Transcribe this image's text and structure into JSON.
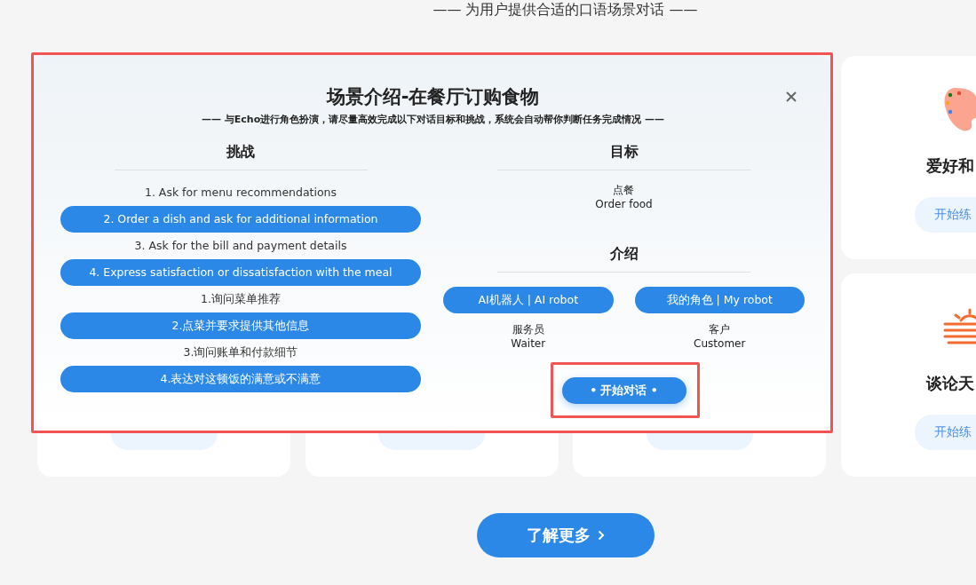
{
  "page_subtitle": "—— 为用户提供合适的口语场景对话 ——",
  "side_cards": [
    {
      "kind": "palette",
      "title": "爱好和",
      "button": "开始练"
    },
    {
      "kind": "sunset",
      "title": "谈论天",
      "button": "开始练"
    }
  ],
  "modal": {
    "title": "场景介绍-在餐厅订购食物",
    "subtitle": "—— 与**Echo**进行角色扮演，请尽量高效完成以下对话目标和挑战，系统会自动帮你判断任务完成情况 ——",
    "challenges": {
      "heading": "挑战",
      "items": [
        {
          "text": "1. Ask for menu recommendations",
          "highlighted": false
        },
        {
          "text": "2. Order a dish and ask for additional information",
          "highlighted": true
        },
        {
          "text": "3. Ask for the bill and payment details",
          "highlighted": false
        },
        {
          "text": "4. Express satisfaction or dissatisfaction with the meal",
          "highlighted": true
        },
        {
          "text": "1.询问菜单推荐",
          "highlighted": false
        },
        {
          "text": "2.点菜并要求提供其他信息",
          "highlighted": true
        },
        {
          "text": "3.询问账单和付款细节",
          "highlighted": false
        },
        {
          "text": "4.表达对这顿饭的满意或不满意",
          "highlighted": true
        }
      ]
    },
    "goal": {
      "heading": "目标",
      "lines": [
        "点餐",
        "Order food"
      ]
    },
    "intro": {
      "heading": "介绍",
      "roles": [
        {
          "label": "AI机器人 | AI robot",
          "lines": [
            "服务员",
            "Waiter"
          ]
        },
        {
          "label": "我的角色 | My robot",
          "lines": [
            "客户",
            "Customer"
          ]
        }
      ]
    },
    "start_button": "• 开始对话 •"
  },
  "more_button": "了解更多"
}
